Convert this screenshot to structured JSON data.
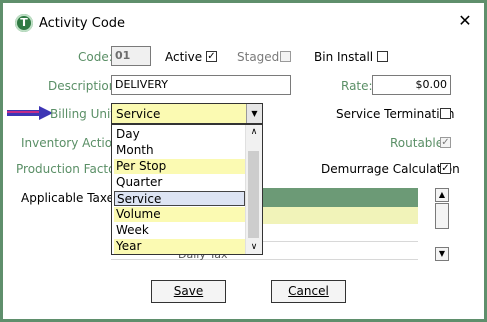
{
  "window": {
    "title": "Activity Code",
    "app_icon_letter": "T",
    "close_glyph": "✕"
  },
  "form": {
    "code_label": "Code:",
    "code_value": "01",
    "active_label": "Active",
    "active_checked": true,
    "staged_label": "Staged",
    "staged_checked": false,
    "bin_install_label": "Bin Install",
    "bin_install_checked": false,
    "description_label": "Description:",
    "description_value": "DELIVERY",
    "rate_label": "Rate:",
    "rate_value": "$0.00",
    "billing_units_label": "Billing Units:",
    "billing_units_value": "Service",
    "service_termination_label": "Service Termination",
    "service_termination_checked": false,
    "inventory_action_label": "Inventory Action:",
    "routable_label": "Routable",
    "routable_checked": true,
    "production_factor_label": "Production Factor:",
    "demurrage_label": "Demurrage Calculation",
    "demurrage_checked": true,
    "applicable_taxes_label": "Applicable Taxes:",
    "taxes_partial_text": "Daily Tax"
  },
  "billing_units_options": [
    {
      "label": "Day",
      "style": "normal"
    },
    {
      "label": "Month",
      "style": "normal"
    },
    {
      "label": "Per Stop",
      "style": "yellow"
    },
    {
      "label": "Quarter",
      "style": "normal"
    },
    {
      "label": "Service",
      "style": "selected"
    },
    {
      "label": "Volume",
      "style": "yellow"
    },
    {
      "label": "Week",
      "style": "normal"
    },
    {
      "label": "Year",
      "style": "yellow"
    }
  ],
  "buttons": {
    "save": "Save",
    "cancel": "Cancel"
  },
  "glyphs": {
    "check": "✓",
    "down": "▼",
    "up": "▲",
    "scroll_down": "∨",
    "scroll_up": "∧"
  },
  "colors": {
    "frame": "#5f8f6c",
    "label_green": "#5a8f66",
    "field_yellow": "#fbfab2",
    "grid_header": "#6c9a76"
  }
}
